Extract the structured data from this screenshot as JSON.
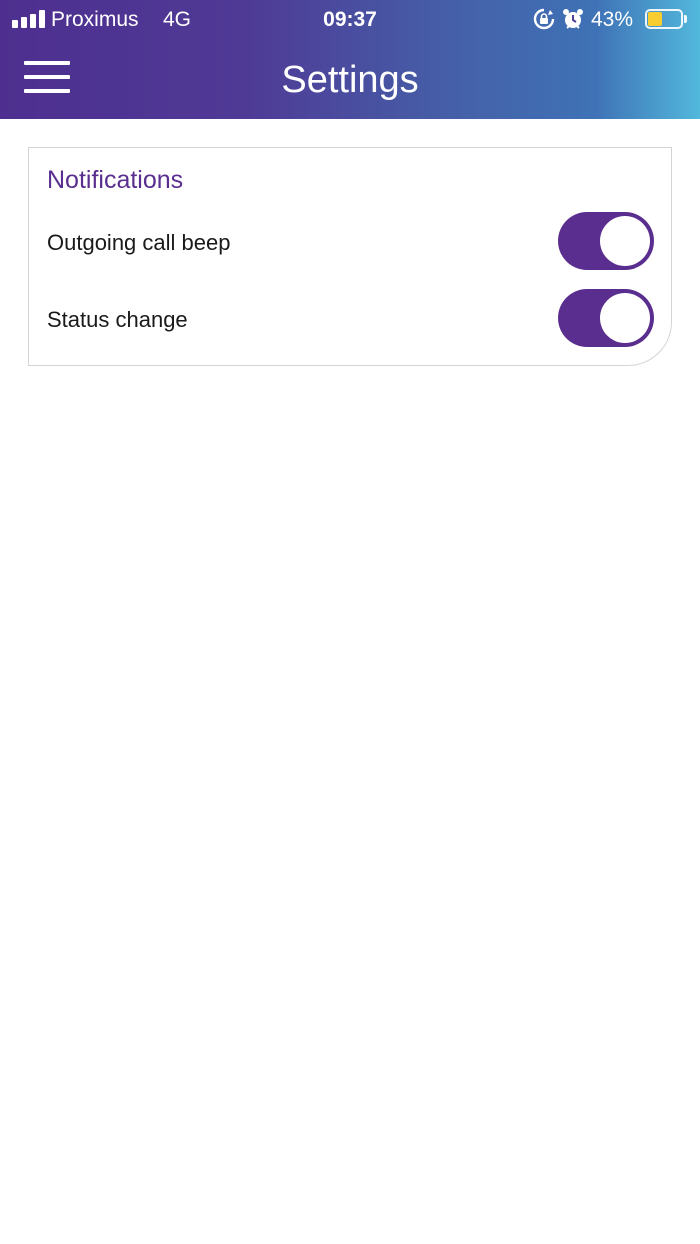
{
  "status_bar": {
    "carrier": "Proximus",
    "network": "4G",
    "time": "09:37",
    "battery_percent": "43%",
    "battery_level": 0.43,
    "icons": [
      "signal-icon",
      "rotation-lock-icon",
      "alarm-icon",
      "battery-icon"
    ]
  },
  "header": {
    "title": "Settings",
    "menu_icon": "hamburger-menu-icon"
  },
  "notifications": {
    "title": "Notifications",
    "items": [
      {
        "label": "Outgoing call beep",
        "enabled": true
      },
      {
        "label": "Status change",
        "enabled": true
      }
    ]
  },
  "colors": {
    "accent": "#5a2e8e",
    "header_gradient_start": "#4e2f8f",
    "header_gradient_end": "#52b8dc",
    "battery_fill": "#f7cd32"
  }
}
